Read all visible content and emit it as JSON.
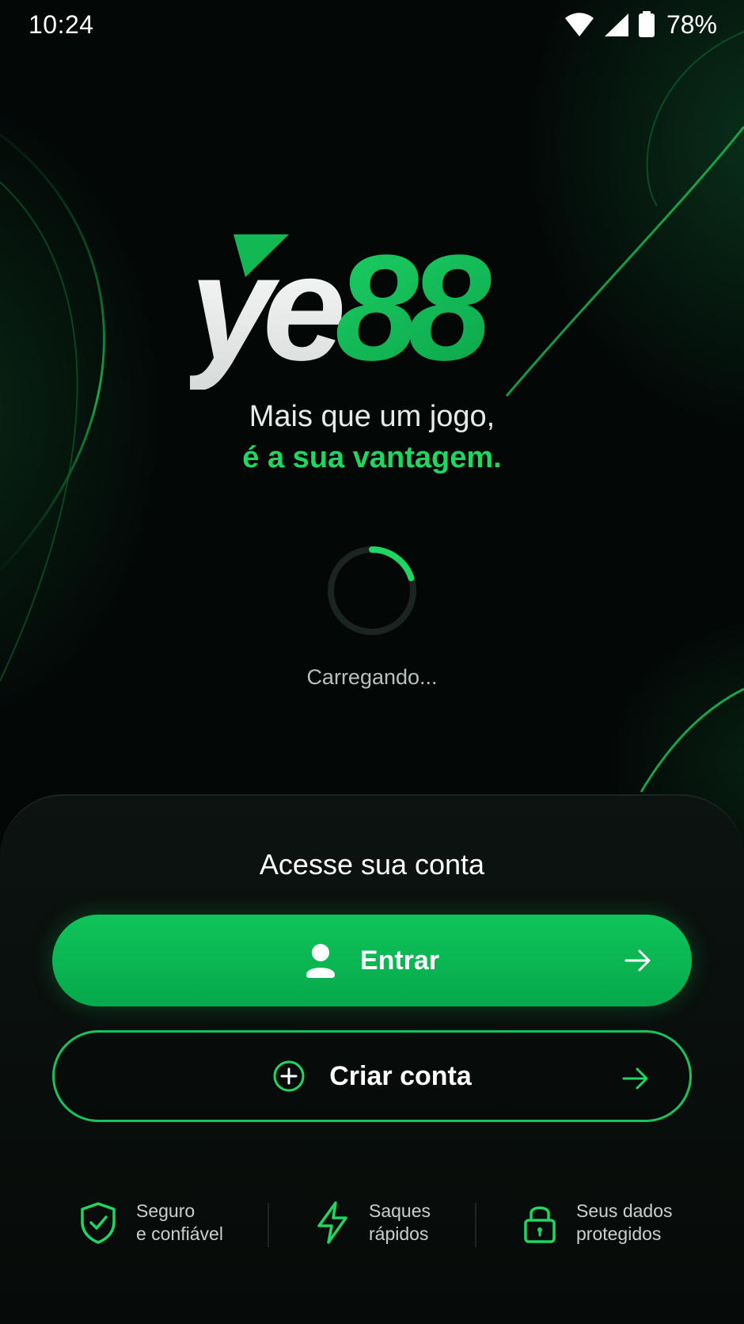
{
  "status_bar": {
    "time": "10:24",
    "battery": "78%",
    "icons": [
      "wifi-icon",
      "signal-icon",
      "battery-icon"
    ]
  },
  "brand": {
    "logo_text_white": "ye",
    "logo_text_green": "88",
    "accent_color": "#1ed760"
  },
  "tagline": {
    "line1": "Mais que um jogo,",
    "line2": "é a sua vantagem."
  },
  "loading": {
    "text": "Carregando...",
    "progress": 0.2
  },
  "account_panel": {
    "title": "Acesse sua conta",
    "login_button": {
      "label": "Entrar",
      "icon": "user-icon",
      "arrow": "arrow-right-icon"
    },
    "signup_button": {
      "label": "Criar conta",
      "icon": "plus-circle-icon",
      "arrow": "arrow-right-icon"
    }
  },
  "features": [
    {
      "icon": "shield-check-icon",
      "line1": "Seguro",
      "line2": "e confiável"
    },
    {
      "icon": "lightning-icon",
      "line1": "Saques",
      "line2": "rápidos"
    },
    {
      "icon": "lock-icon",
      "line1": "Seus dados",
      "line2": "protegidos"
    }
  ]
}
